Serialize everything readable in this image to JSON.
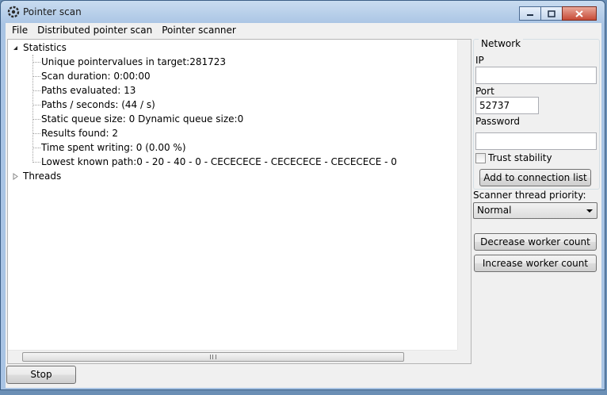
{
  "window": {
    "title": "Pointer scan",
    "icons": {
      "app": "cheat-engine-icon",
      "minimize": "minimize-icon",
      "maximize": "maximize-icon",
      "close": "close-icon"
    }
  },
  "menu": [
    "File",
    "Distributed pointer scan",
    "Pointer scanner"
  ],
  "tree": {
    "statistics_label": "Statistics",
    "statistics_items": [
      "Unique pointervalues in target:281723",
      "Scan duration: 0:00:00",
      "Paths evaluated: 13",
      "Paths / seconds: (44 / s)",
      "Static queue size: 0 Dynamic queue size:0",
      "Results found: 2",
      "Time spent writing: 0 (0.00 %)",
      "Lowest known path:0 - 20 - 40 - 0 - CECECECE - CECECECE - CECECECE - 0"
    ],
    "threads_label": "Threads"
  },
  "network": {
    "group_label": "Network",
    "ip_label": "IP",
    "ip_value": "",
    "port_label": "Port",
    "port_value": "52737",
    "password_label": "Password",
    "password_value": "",
    "trust_stability_label": "Trust stability",
    "trust_stability_checked": false,
    "add_button": "Add to connection list"
  },
  "scanner": {
    "priority_label": "Scanner thread priority:",
    "priority_value": "Normal",
    "decrease_button": "Decrease worker count",
    "increase_button": "Increase worker count"
  },
  "stop_button": "Stop"
}
